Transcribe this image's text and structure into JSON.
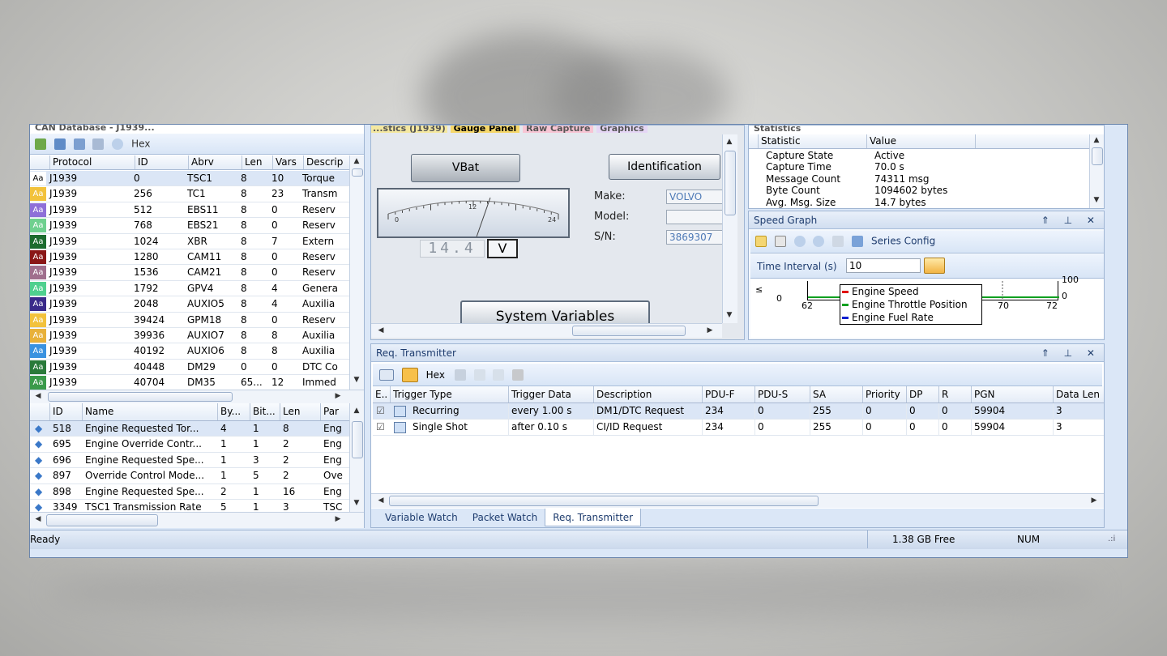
{
  "window": {
    "status": "Ready",
    "free_space": "1.38 GB Free",
    "num_lock": "NUM"
  },
  "top_cut": {
    "left_title": "CAN Database - J1939...",
    "tab_partial_1": "...stics (J1939)",
    "tab_active": "Gauge Panel",
    "tab_2": "Raw Capture",
    "tab_3": "Graphics",
    "stats_title": "Statistics"
  },
  "database": {
    "toolbar": {
      "hex_label": "Hex"
    },
    "columns": [
      "Protocol",
      "ID",
      "Abrv",
      "Len",
      "Vars",
      "Descrip"
    ],
    "rows": [
      {
        "color": "#ffffff",
        "proto": "J1939",
        "id": "0",
        "abrv": "TSC1",
        "len": "8",
        "vars": "10",
        "desc": "Torque"
      },
      {
        "color": "#f2c23c",
        "proto": "J1939",
        "id": "256",
        "abrv": "TC1",
        "len": "8",
        "vars": "23",
        "desc": "Transm"
      },
      {
        "color": "#8e6fd8",
        "proto": "J1939",
        "id": "512",
        "abrv": "EBS11",
        "len": "8",
        "vars": "0",
        "desc": "Reserv"
      },
      {
        "color": "#6fd08f",
        "proto": "J1939",
        "id": "768",
        "abrv": "EBS21",
        "len": "8",
        "vars": "0",
        "desc": "Reserv"
      },
      {
        "color": "#1c6b2e",
        "proto": "J1939",
        "id": "1024",
        "abrv": "XBR",
        "len": "8",
        "vars": "7",
        "desc": "Extern"
      },
      {
        "color": "#8a1717",
        "proto": "J1939",
        "id": "1280",
        "abrv": "CAM11",
        "len": "8",
        "vars": "0",
        "desc": "Reserv"
      },
      {
        "color": "#a06f8d",
        "proto": "J1939",
        "id": "1536",
        "abrv": "CAM21",
        "len": "8",
        "vars": "0",
        "desc": "Reserv"
      },
      {
        "color": "#4fd08f",
        "proto": "J1939",
        "id": "1792",
        "abrv": "GPV4",
        "len": "8",
        "vars": "4",
        "desc": "Genera"
      },
      {
        "color": "#3a2a8a",
        "proto": "J1939",
        "id": "2048",
        "abrv": "AUXIO5",
        "len": "8",
        "vars": "4",
        "desc": "Auxilia"
      },
      {
        "color": "#f2c23c",
        "proto": "J1939",
        "id": "39424",
        "abrv": "GPM18",
        "len": "8",
        "vars": "0",
        "desc": "Reserv"
      },
      {
        "color": "#e8b13a",
        "proto": "J1939",
        "id": "39936",
        "abrv": "AUXIO7",
        "len": "8",
        "vars": "8",
        "desc": "Auxilia"
      },
      {
        "color": "#3a92e0",
        "proto": "J1939",
        "id": "40192",
        "abrv": "AUXIO6",
        "len": "8",
        "vars": "8",
        "desc": "Auxilia"
      },
      {
        "color": "#2a7a3a",
        "proto": "J1939",
        "id": "40448",
        "abrv": "DM29",
        "len": "0",
        "vars": "0",
        "desc": "DTC Co"
      },
      {
        "color": "#3a9a4a",
        "proto": "J1939",
        "id": "40704",
        "abrv": "DM35",
        "len": "65...",
        "vars": "12",
        "desc": "Immed"
      }
    ]
  },
  "variables": {
    "columns": [
      "ID",
      "Name",
      "By...",
      "Bit...",
      "Len",
      "Par"
    ],
    "rows": [
      {
        "id": "518",
        "name": "Engine Requested Tor...",
        "by": "4",
        "bit": "1",
        "len": "8",
        "par": "Eng"
      },
      {
        "id": "695",
        "name": "Engine Override Contr...",
        "by": "1",
        "bit": "1",
        "len": "2",
        "par": "Eng"
      },
      {
        "id": "696",
        "name": "Engine Requested Spe...",
        "by": "1",
        "bit": "3",
        "len": "2",
        "par": "Eng"
      },
      {
        "id": "897",
        "name": "Override Control Mode...",
        "by": "1",
        "bit": "5",
        "len": "2",
        "par": "Ove"
      },
      {
        "id": "898",
        "name": "Engine Requested Spe...",
        "by": "2",
        "bit": "1",
        "len": "16",
        "par": "Eng"
      },
      {
        "id": "3349",
        "name": "TSC1 Transmission Rate",
        "by": "5",
        "bit": "1",
        "len": "3",
        "par": "TSC"
      }
    ]
  },
  "gauge": {
    "vbat_label": "VBat",
    "ident_label": "Identification",
    "make_label": "Make:",
    "make_value": "VOLVO",
    "model_label": "Model:",
    "model_value": "",
    "sn_label": "S/N:",
    "sn_value": "3869307",
    "tick_min": "0",
    "tick_mid": "12",
    "tick_max": "24",
    "digital_value": "14.4",
    "unit": "V",
    "sysvars_label": "System Variables",
    "needle_fraction": 0.6
  },
  "stats": {
    "columns": [
      "Statistic",
      "Value"
    ],
    "rows": [
      {
        "k": "Capture State",
        "v": "Active"
      },
      {
        "k": "Capture Time",
        "v": "70.0 s"
      },
      {
        "k": "Message Count",
        "v": "74311 msg"
      },
      {
        "k": "Byte Count",
        "v": "1094602 bytes"
      },
      {
        "k": "Avg. Msg. Size",
        "v": "14.7 bytes"
      }
    ]
  },
  "speed_graph": {
    "title": "Speed Graph",
    "series_config": "Series Config",
    "interval_label": "Time Interval (s)",
    "interval_value": "10",
    "y_left_unit": "≤",
    "y_left_zero": "0",
    "y_right_top": "100",
    "y_right_zero": "0",
    "x_ticks": [
      "62",
      "70",
      "72"
    ],
    "legend": [
      {
        "name": "Engine Speed",
        "color": "#e01010"
      },
      {
        "name": "Engine Throttle Position",
        "color": "#10a020"
      },
      {
        "name": "Engine Fuel Rate",
        "color": "#1020d0"
      }
    ]
  },
  "transmitter": {
    "title": "Req. Transmitter",
    "hex_label": "Hex",
    "columns": [
      "E..",
      "Trigger Type",
      "Trigger Data",
      "Description",
      "PDU-F",
      "PDU-S",
      "SA",
      "Priority",
      "DP",
      "R",
      "PGN",
      "Data Len"
    ],
    "rows": [
      {
        "type": "Recurring",
        "data": "every 1.00 s",
        "desc": "DM1/DTC Request",
        "pduf": "234",
        "pdus": "0",
        "sa": "255",
        "prio": "0",
        "dp": "0",
        "r": "0",
        "pgn": "59904",
        "dlen": "3"
      },
      {
        "type": "Single Shot",
        "data": "after 0.10 s",
        "desc": "CI/ID Request",
        "pduf": "234",
        "pdus": "0",
        "sa": "255",
        "prio": "0",
        "dp": "0",
        "r": "0",
        "pgn": "59904",
        "dlen": "3"
      }
    ],
    "tabs": [
      "Variable Watch",
      "Packet Watch",
      "Req. Transmitter"
    ]
  }
}
